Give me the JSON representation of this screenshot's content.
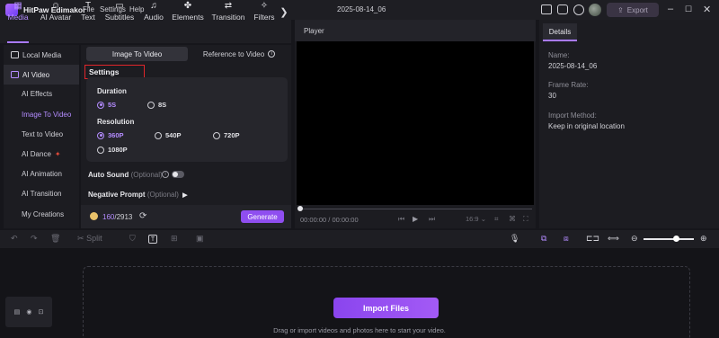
{
  "app": {
    "name": "HitPaw Edimakor",
    "menus": [
      "File",
      "Settings",
      "Help"
    ],
    "project_title": "2025-08-14_06",
    "export_label": "Export"
  },
  "toolbar": {
    "items": [
      "Media",
      "AI Avatar",
      "Text",
      "Subtitles",
      "Audio",
      "Elements",
      "Transition",
      "Filters"
    ],
    "more": "❯"
  },
  "sidebar": {
    "local_media": "Local Media",
    "ai_video": "AI Video",
    "items": [
      "AI Effects",
      "Image To Video",
      "Text to Video",
      "AI Dance",
      "AI Animation",
      "AI Transition",
      "My Creations"
    ]
  },
  "panel": {
    "tabs": [
      "Image To Video",
      "Reference to Video"
    ],
    "settings_label": "Settings",
    "duration_label": "Duration",
    "durations": [
      "5S",
      "8S"
    ],
    "resolution_label": "Resolution",
    "resolutions": [
      "360P",
      "540P",
      "720P",
      "1080P"
    ],
    "auto_sound_label": "Auto Sound",
    "auto_sound_optional": "(Optional)",
    "negative_prompt_label": "Negative Prompt",
    "negative_prompt_optional": "(Optional)",
    "credits_used": "160",
    "credits_total": "/2913",
    "generate_label": "Generate"
  },
  "player": {
    "title": "Player",
    "time_current": "00:00:00",
    "time_total": " / 00:00:00",
    "aspect": "16:9"
  },
  "details": {
    "tab": "Details",
    "name_label": "Name:",
    "name_value": "2025-08-14_06",
    "frame_rate_label": "Frame Rate:",
    "frame_rate_value": "30",
    "import_method_label": "Import Method:",
    "import_method_value": "Keep in original location"
  },
  "timeline": {
    "split_label": "Split",
    "import_files": "Import Files",
    "drop_hint": "Drag or import videos and photos here to start your video."
  }
}
